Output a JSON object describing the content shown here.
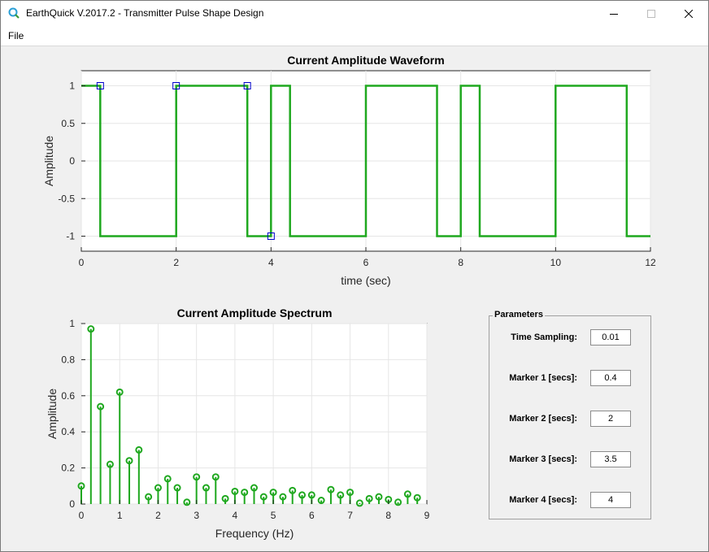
{
  "window": {
    "title": "EarthQuick V.2017.2 - Transmitter Pulse Shape Design",
    "menu": [
      "File"
    ]
  },
  "colors": {
    "trace": "#1fa81f",
    "marker": "#0000cc",
    "grid": "#e6e6e6"
  },
  "chart_data": [
    {
      "type": "line",
      "title": "Current Amplitude Waveform",
      "xlabel": "time (sec)",
      "ylabel": "Amplitude",
      "xlim": [
        0,
        12
      ],
      "ylim": [
        -1.2,
        1.2
      ],
      "xticks": [
        "0",
        "2",
        "4",
        "6",
        "8",
        "10",
        "12"
      ],
      "yticks": [
        "1",
        "0.5",
        "0",
        "-0.5",
        "-1"
      ],
      "grid": true,
      "x": [
        0,
        0.4,
        0.4,
        2,
        2,
        3.5,
        3.5,
        4,
        4,
        4.4,
        4.4,
        6,
        6,
        7.5,
        7.5,
        8,
        8,
        8.4,
        8.4,
        10,
        10,
        11.5,
        11.5,
        12
      ],
      "y": [
        1,
        1,
        -1,
        -1,
        1,
        1,
        -1,
        -1,
        1,
        1,
        -1,
        -1,
        1,
        1,
        -1,
        -1,
        1,
        1,
        -1,
        -1,
        1,
        1,
        -1,
        -1
      ],
      "markers": [
        [
          0.4,
          1
        ],
        [
          2,
          1
        ],
        [
          3.5,
          1
        ],
        [
          4,
          -1
        ]
      ]
    },
    {
      "type": "stem",
      "title": "Current Amplitude Spectrum",
      "xlabel": "Frequency (Hz)",
      "ylabel": "Amplitude",
      "xlim": [
        0,
        9
      ],
      "ylim": [
        0,
        1
      ],
      "xticks": [
        "0",
        "1",
        "2",
        "3",
        "4",
        "5",
        "6",
        "7",
        "8",
        "9"
      ],
      "yticks": [
        "1",
        "0.8",
        "0.6",
        "0.4",
        "0.2",
        "0"
      ],
      "grid": true,
      "x": [
        0,
        0.25,
        0.5,
        0.75,
        1,
        1.25,
        1.5,
        1.75,
        2,
        2.25,
        2.5,
        2.75,
        3,
        3.25,
        3.5,
        3.75,
        4,
        4.25,
        4.5,
        4.75,
        5,
        5.25,
        5.5,
        5.75,
        6,
        6.25,
        6.5,
        6.75,
        7,
        7.25,
        7.5,
        7.75,
        8,
        8.25,
        8.5,
        8.75
      ],
      "y": [
        0.1,
        0.97,
        0.54,
        0.22,
        0.62,
        0.24,
        0.3,
        0.04,
        0.09,
        0.14,
        0.09,
        0.01,
        0.15,
        0.09,
        0.15,
        0.03,
        0.07,
        0.065,
        0.09,
        0.04,
        0.065,
        0.04,
        0.075,
        0.05,
        0.05,
        0.02,
        0.08,
        0.05,
        0.065,
        0.005,
        0.03,
        0.04,
        0.025,
        0.01,
        0.055,
        0.035
      ]
    }
  ],
  "parameters": {
    "legend": "Parameters",
    "fields": [
      {
        "label": "Time Sampling:",
        "value": "0.01"
      },
      {
        "label": "Marker 1 [secs]:",
        "value": "0.4"
      },
      {
        "label": "Marker 2 [secs]:",
        "value": "2"
      },
      {
        "label": "Marker 3 [secs]:",
        "value": "3.5"
      },
      {
        "label": "Marker 4 [secs]:",
        "value": "4"
      }
    ]
  }
}
